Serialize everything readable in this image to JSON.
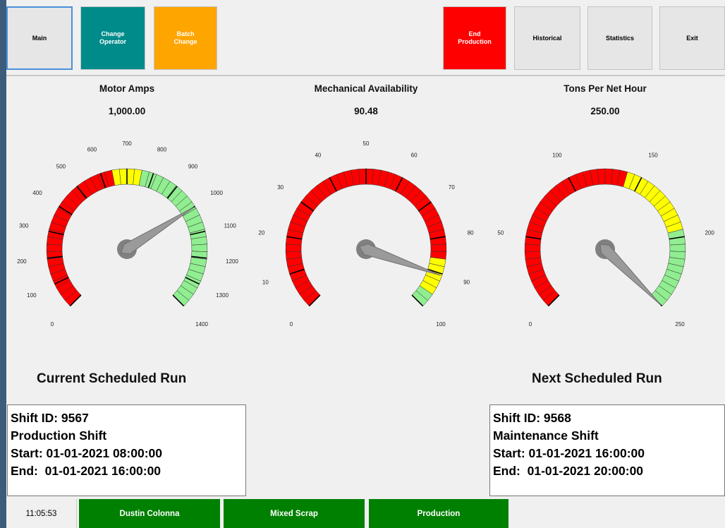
{
  "colors": {
    "red": "#ff0000",
    "yellow": "#ffff00",
    "green": "#90ee90",
    "teal": "#008b8b",
    "orange": "#ffa500",
    "status_green": "#008000"
  },
  "toolbar": [
    {
      "label": "Main",
      "bg": "#e6e6e6",
      "fg": "#000000"
    },
    {
      "label": "Change\nOperator",
      "bg": "#008b8b",
      "fg": "#ffffff"
    },
    {
      "label": "Batch\nChange",
      "bg": "#ffa500",
      "fg": "#ffffff"
    },
    {
      "label": "End\nProduction",
      "bg": "#ff0000",
      "fg": "#ffffff"
    },
    {
      "label": "Historical",
      "bg": "#e6e6e6",
      "fg": "#000000"
    },
    {
      "label": "Statistics",
      "bg": "#e6e6e6",
      "fg": "#000000"
    },
    {
      "label": "Exit",
      "bg": "#e6e6e6",
      "fg": "#000000"
    }
  ],
  "gauges": [
    {
      "title": "Motor Amps",
      "value_text": "1,000.00",
      "value": 1000,
      "min": 0,
      "max": 1400,
      "ticks": [
        0,
        100,
        200,
        300,
        400,
        500,
        600,
        700,
        800,
        900,
        1000,
        1100,
        1200,
        1300,
        1400
      ],
      "ranges": [
        {
          "from": 0,
          "to": 640,
          "color": "red"
        },
        {
          "from": 640,
          "to": 760,
          "color": "yellow"
        },
        {
          "from": 760,
          "to": 1400,
          "color": "green"
        }
      ]
    },
    {
      "title": "Mechanical Availability",
      "value_text": "90.48",
      "value": 90.48,
      "min": 0,
      "max": 100,
      "ticks": [
        0,
        10,
        20,
        30,
        40,
        50,
        60,
        70,
        80,
        90,
        100
      ],
      "ranges": [
        {
          "from": 0,
          "to": 85,
          "color": "red"
        },
        {
          "from": 85,
          "to": 95,
          "color": "yellow"
        },
        {
          "from": 95,
          "to": 100,
          "color": "green"
        }
      ]
    },
    {
      "title": "Tons Per Net Hour",
      "value_text": "250.00",
      "value": 250,
      "min": 0,
      "max": 250,
      "ticks": [
        0,
        50,
        100,
        150,
        200,
        250
      ],
      "ranges": [
        {
          "from": 0,
          "to": 140,
          "color": "red"
        },
        {
          "from": 140,
          "to": 195,
          "color": "yellow"
        },
        {
          "from": 195,
          "to": 250,
          "color": "green"
        }
      ]
    }
  ],
  "current_run": {
    "heading": "Current Scheduled Run",
    "lines": [
      "Shift ID: 9567",
      "Production Shift",
      "Start: 01-01-2021 08:00:00",
      "End:  01-01-2021 16:00:00"
    ]
  },
  "next_run": {
    "heading": "Next Scheduled Run",
    "lines": [
      "Shift ID: 9568",
      "Maintenance Shift",
      "Start: 01-01-2021 16:00:00",
      "End:  01-01-2021 20:00:00"
    ]
  },
  "status": {
    "time": "11:05:53",
    "operator": "Dustin Colonna",
    "material": "Mixed Scrap",
    "mode": "Production"
  }
}
